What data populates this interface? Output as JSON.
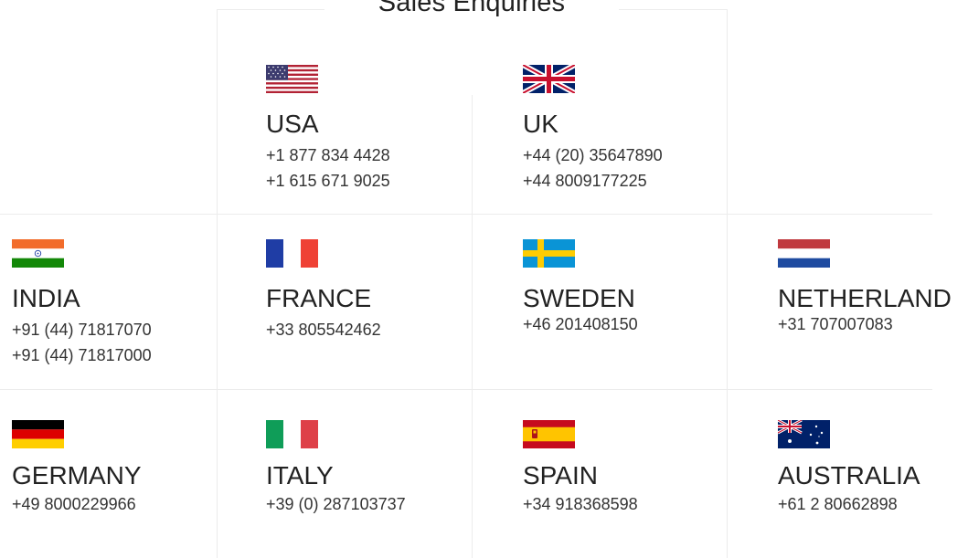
{
  "page": {
    "title": "Sales Enquiries"
  },
  "countries": [
    {
      "name": "USA",
      "phones": [
        "+1 877 834 4428",
        "+1 615 671 9025"
      ],
      "flag_icon": "us-flag-icon"
    },
    {
      "name": "UK",
      "phones": [
        "+44 (20) 35647890",
        "+44 8009177225"
      ],
      "flag_icon": "uk-flag-icon"
    },
    {
      "name": "INDIA",
      "phones": [
        "+91 (44) 71817070",
        "+91 (44) 71817000"
      ],
      "flag_icon": "india-flag-icon"
    },
    {
      "name": "FRANCE",
      "phones": [
        "+33 805542462"
      ],
      "flag_icon": "france-flag-icon"
    },
    {
      "name": "SWEDEN",
      "phones": [
        "+46 201408150"
      ],
      "flag_icon": "sweden-flag-icon"
    },
    {
      "name": "NETHERLAND",
      "phones": [
        "+31 707007083"
      ],
      "flag_icon": "netherlands-flag-icon"
    },
    {
      "name": "GERMANY",
      "phones": [
        "+49 8000229966"
      ],
      "flag_icon": "germany-flag-icon"
    },
    {
      "name": "ITALY",
      "phones": [
        "+39 (0) 287103737"
      ],
      "flag_icon": "italy-flag-icon"
    },
    {
      "name": "SPAIN",
      "phones": [
        "+34 918368598"
      ],
      "flag_icon": "spain-flag-icon"
    },
    {
      "name": "AUSTRALIA",
      "phones": [
        "+61 2 80662898"
      ],
      "flag_icon": "australia-flag-icon"
    }
  ],
  "colors": {
    "divider": "#ececec",
    "text": "#222222",
    "us_red": "#B22234",
    "us_blue": "#3C3B6E",
    "uk_blue": "#012169",
    "uk_red": "#C8102E",
    "india_saffron": "#F26C2B",
    "india_green": "#138808",
    "france_blue": "#1F3DA5",
    "france_red": "#EF4135",
    "sweden_blue": "#0A94D6",
    "sweden_yellow": "#FECC02",
    "netherlands_red": "#C0393E",
    "netherlands_blue": "#1E4BA0",
    "germany_red": "#DD0000",
    "germany_gold": "#FFCE00",
    "italy_green": "#0F9D58",
    "italy_red": "#DE4048",
    "spain_red": "#C60B1E",
    "spain_yellow": "#FFC400"
  }
}
